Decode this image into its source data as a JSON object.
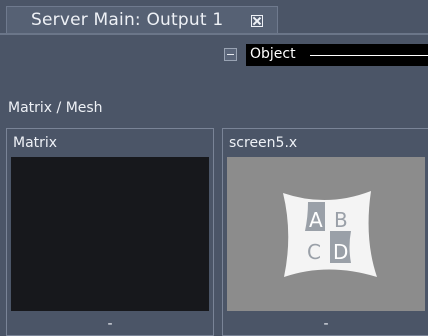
{
  "tab": {
    "title": "Server Main: Output 1"
  },
  "object": {
    "label": "Object"
  },
  "section": {
    "label": "Matrix / Mesh"
  },
  "panels": [
    {
      "title": "Matrix",
      "footer": "-"
    },
    {
      "title": "screen5.x",
      "footer": "-",
      "letters": [
        "A",
        "B",
        "C",
        "D"
      ]
    }
  ],
  "colors": {
    "background": "#4b5567",
    "viewport_dark": "#17181c",
    "viewport_grey": "#8c8c8c"
  }
}
